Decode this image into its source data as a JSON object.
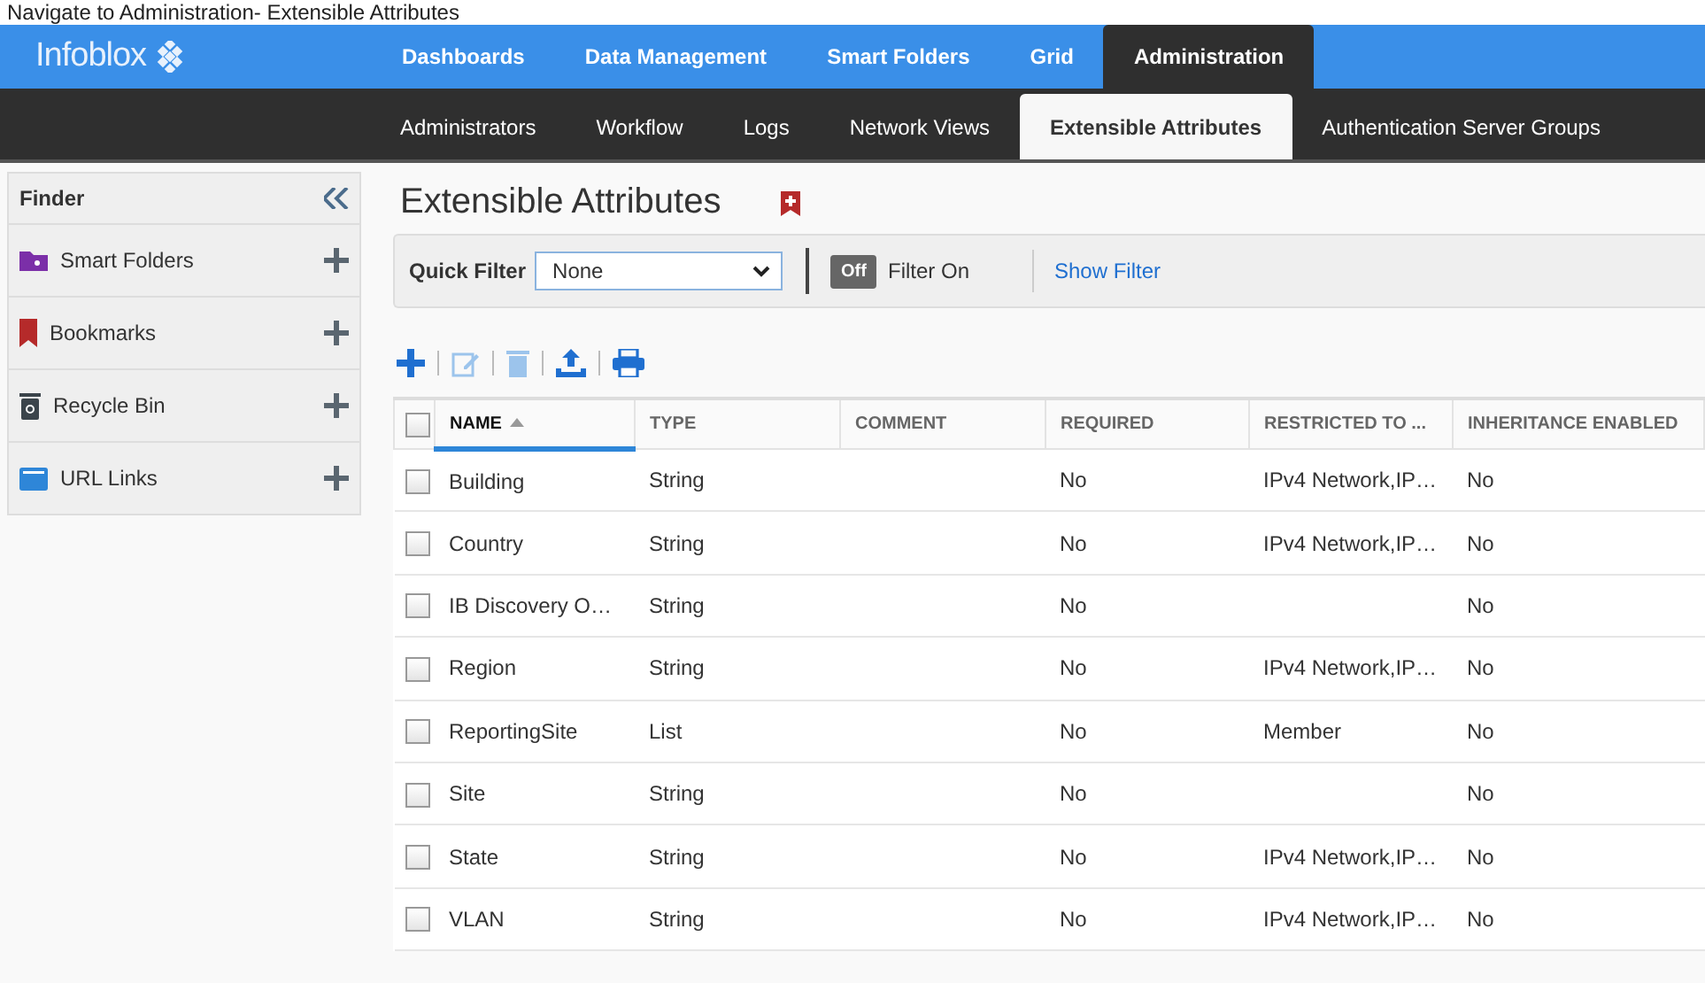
{
  "caption": "Navigate to Administration- Extensible Attributes",
  "brand": "Infoblox",
  "main_tabs": [
    {
      "label": "Dashboards",
      "selected": false
    },
    {
      "label": "Data Management",
      "selected": false
    },
    {
      "label": "Smart Folders",
      "selected": false
    },
    {
      "label": "Grid",
      "selected": false
    },
    {
      "label": "Administration",
      "selected": true
    }
  ],
  "sub_tabs": [
    {
      "label": "Administrators",
      "selected": false
    },
    {
      "label": "Workflow",
      "selected": false
    },
    {
      "label": "Logs",
      "selected": false
    },
    {
      "label": "Network Views",
      "selected": false
    },
    {
      "label": "Extensible Attributes",
      "selected": true
    },
    {
      "label": "Authentication Server Groups",
      "selected": false
    }
  ],
  "finder": {
    "title": "Finder",
    "items": [
      {
        "label": "Smart Folders",
        "kind": "folder"
      },
      {
        "label": "Bookmarks",
        "kind": "bookmark"
      },
      {
        "label": "Recycle Bin",
        "kind": "bin"
      },
      {
        "label": "URL Links",
        "kind": "link"
      }
    ]
  },
  "page_title": "Extensible Attributes",
  "quick_filter": {
    "label": "Quick Filter",
    "value": "None",
    "toggle": "Off",
    "on": false,
    "toggle_label": "Filter On",
    "show_filter": "Show Filter"
  },
  "toolbar": [
    {
      "kind": "add",
      "disabled": false
    },
    {
      "kind": "edit",
      "disabled": true
    },
    {
      "kind": "delete",
      "disabled": true
    },
    {
      "kind": "export",
      "disabled": false
    },
    {
      "kind": "print",
      "disabled": false
    }
  ],
  "table": {
    "select_all_checked": false,
    "columns": [
      {
        "label": "NAME",
        "sorted": true
      },
      {
        "label": "TYPE",
        "sorted": false
      },
      {
        "label": "COMMENT",
        "sorted": false
      },
      {
        "label": "REQUIRED",
        "sorted": false
      },
      {
        "label": "RESTRICTED TO ...",
        "sorted": false
      },
      {
        "label": "INHERITANCE ENABLED",
        "sorted": false
      }
    ],
    "rows": [
      {
        "checked": false,
        "cells": [
          "Building",
          "String",
          "",
          "No",
          "IPv4 Network,IP…",
          "No"
        ]
      },
      {
        "checked": false,
        "cells": [
          "Country",
          "String",
          "",
          "No",
          "IPv4 Network,IP…",
          "No"
        ]
      },
      {
        "checked": false,
        "cells": [
          "IB Discovery O…",
          "String",
          "",
          "No",
          "",
          "No"
        ]
      },
      {
        "checked": false,
        "cells": [
          "Region",
          "String",
          "",
          "No",
          "IPv4 Network,IP…",
          "No"
        ]
      },
      {
        "checked": false,
        "cells": [
          "ReportingSite",
          "List",
          "",
          "No",
          "Member",
          "No"
        ]
      },
      {
        "checked": false,
        "cells": [
          "Site",
          "String",
          "",
          "No",
          "",
          "No"
        ]
      },
      {
        "checked": false,
        "cells": [
          "State",
          "String",
          "",
          "No",
          "IPv4 Network,IP…",
          "No"
        ]
      },
      {
        "checked": false,
        "cells": [
          "VLAN",
          "String",
          "",
          "No",
          "IPv4 Network,IP…",
          "No"
        ]
      }
    ]
  }
}
